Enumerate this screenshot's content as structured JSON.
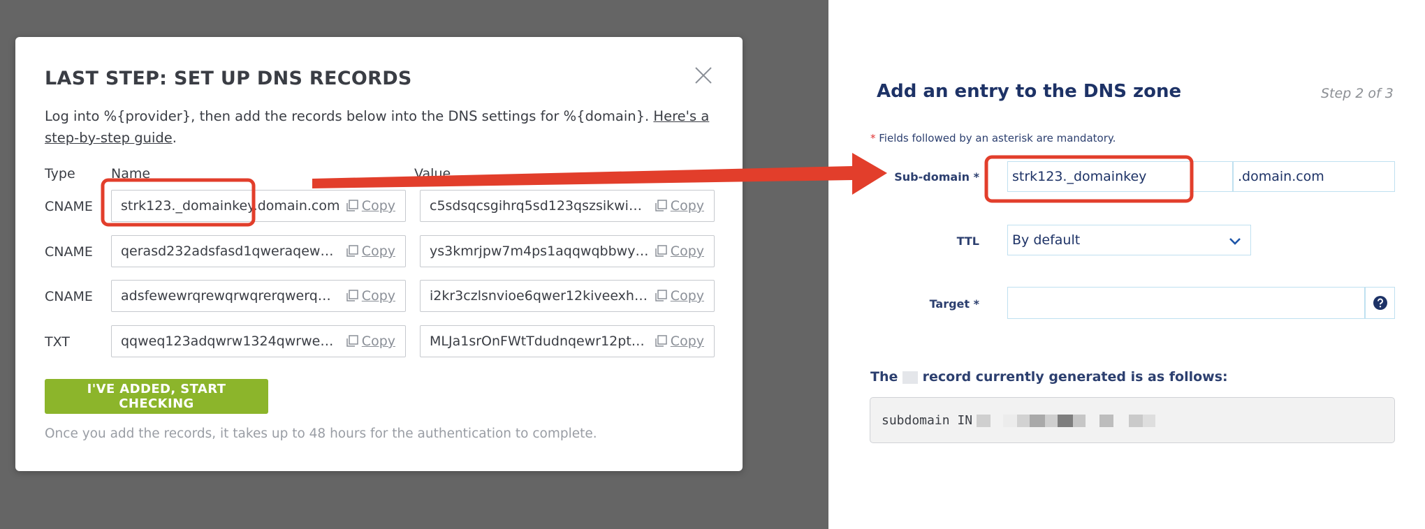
{
  "modal": {
    "title": "LAST STEP: SET UP DNS RECORDS",
    "intro_text": "Log into %{provider}, then add the records below into the DNS settings for %{domain}. ",
    "intro_link": "Here's a step-by-step guide",
    "intro_end": ".",
    "columns": {
      "type": "Type",
      "name": "Name",
      "value": "Value"
    },
    "copy_label": "Copy",
    "records": [
      {
        "type": "CNAME",
        "name": "strk123._domainkey.domain.com",
        "value": "c5sdsqcsgihrq5sd123qszsikwi2t…"
      },
      {
        "type": "CNAME",
        "name": "qerasd232adsfasd1qweraqew12…",
        "value": "ys3kmrjpw7m4ps1aqqwqbbwyx…"
      },
      {
        "type": "CNAME",
        "name": "adsfewewrqrewqrwqrerqwerqw…",
        "value": "i2kr3czlsnvioe6qwer12kiveexha5…"
      },
      {
        "type": "TXT",
        "name": "qqweq123adqwrw1324qwrweqe…",
        "value": "MLJa1srOnFWtTdudnqewr12pt1j…"
      }
    ],
    "check_button": "I'VE ADDED, START CHECKING",
    "footnote": "Once you add the records, it takes up to 48 hours for the authentication to complete."
  },
  "form": {
    "title": "Add an entry to the DNS zone",
    "step": "Step 2 of 3",
    "mandatory_asterisk": "*",
    "mandatory_text": " Fields followed by an asterisk are mandatory.",
    "subdomain_label": "Sub-domain *",
    "subdomain_value": "strk123._domainkey",
    "domain_suffix": ".domain.com",
    "ttl_label": "TTL",
    "ttl_value": "By default",
    "target_label": "Target *",
    "target_value": "",
    "generated_label_start": "The",
    "generated_label_end": "record currently generated is as follows:",
    "generated_prefix": "subdomain IN"
  },
  "colors": {
    "highlight": "#e23e2b",
    "button_green": "#8cb52b",
    "form_navy": "#1d3266",
    "backdrop": "#656565"
  },
  "icons": [
    "close-icon",
    "copy-icon",
    "chevron-down-icon",
    "help-icon",
    "arrow-annotation"
  ]
}
